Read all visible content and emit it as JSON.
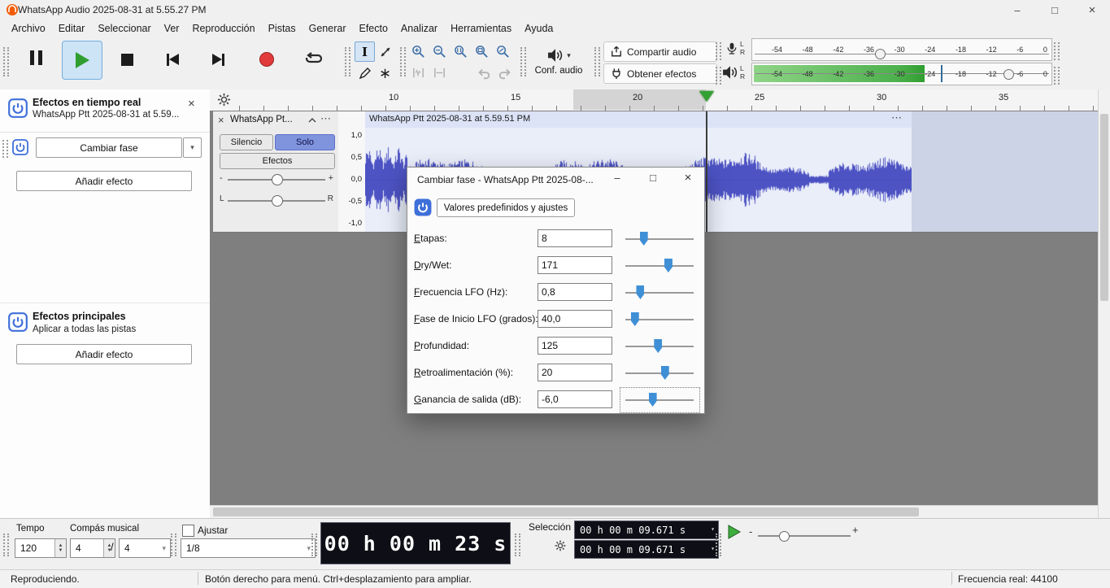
{
  "window": {
    "title": "WhatsApp Audio 2025-08-31 at 5.55.27 PM"
  },
  "menu": {
    "items": [
      "Archivo",
      "Editar",
      "Seleccionar",
      "Ver",
      "Reproducción",
      "Pistas",
      "Generar",
      "Efecto",
      "Analizar",
      "Herramientas",
      "Ayuda"
    ]
  },
  "toolbars": {
    "audio_setup_label": "Conf. audio",
    "share_audio_label": "Compartir audio",
    "get_effects_label": "Obtener efectos",
    "meter_scale": [
      "-54",
      "-48",
      "-42",
      "-36",
      "-30",
      "-24",
      "-18",
      "-12",
      "-6",
      "0"
    ],
    "meter_channel_left": "L",
    "meter_channel_right": "R"
  },
  "timeline": {
    "ticks": [
      "10",
      "15",
      "20",
      "25",
      "30",
      "35"
    ]
  },
  "realtime_panel": {
    "title": "Efectos en tiempo real",
    "subtitle": "WhatsApp Ptt 2025-08-31 at 5.59...",
    "effect_name": "Cambiar fase",
    "add_effect": "Añadir efecto",
    "master_title": "Efectos principales",
    "master_subtitle": "Aplicar a todas las pistas",
    "master_add_effect": "Añadir efecto"
  },
  "track": {
    "name": "WhatsApp Pt...",
    "clip_title": "WhatsApp Ptt 2025-08-31 at 5.59.51 PM",
    "mute_label": "Silencio",
    "solo_label": "Solo",
    "effects_label": "Efectos",
    "gain_minus": "-",
    "gain_plus": "+",
    "pan_left": "L",
    "pan_right": "R",
    "scale": [
      "1,0",
      "0,5",
      "0,0",
      "-0,5",
      "-1,0"
    ]
  },
  "dialog": {
    "title": "Cambiar fase - WhatsApp Ptt 2025-08-...",
    "presets_button": "Valores predefinidos y ajustes",
    "fields": [
      {
        "label": "Etapas:",
        "value": "8",
        "slider": 27
      },
      {
        "label": "Dry/Wet:",
        "value": "171",
        "slider": 63
      },
      {
        "label": "Frecuencia LFO (Hz):",
        "value": "0,8",
        "slider": 22
      },
      {
        "label": "Fase de Inicio LFO (grados):",
        "value": "40,0",
        "slider": 14
      },
      {
        "label": "Profundidad:",
        "value": "125",
        "slider": 48
      },
      {
        "label": "Retroalimentación (%):",
        "value": "20",
        "slider": 58
      },
      {
        "label": "Ganancia de salida (dB):",
        "value": "-6,0",
        "slider": 40
      }
    ]
  },
  "bottom": {
    "tempo_label": "Tempo",
    "tempo_value": "120",
    "time_sig_label": "Compás musical",
    "time_sig_upper": "4",
    "time_sig_divider": "/",
    "time_sig_lower": "4",
    "snap_label": "Ajustar",
    "snap_value": "1/8",
    "time_display": "00 h 00 m 23 s",
    "selection_label": "Selección",
    "selection_start": "00 h 00 m 09.671 s",
    "selection_end": "00 h 00 m 09.671 s",
    "speed_minus": "-",
    "speed_plus": "+"
  },
  "status": {
    "left": "Reproduciendo.",
    "middle": "Botón derecho para menú. Ctrl+desplazamiento para ampliar.",
    "right": "Frecuencia real: 44100"
  },
  "icons": {
    "close": "×",
    "minimize": "–",
    "maximize": "□",
    "chevron_down": "▾",
    "ellipsis": "⋯"
  },
  "colors": {
    "waveform": "#4d53c3",
    "meter_green_light": "#8fd487",
    "meter_green_dark": "#2f9e2f",
    "accent_blue": "#3f8fd6",
    "record_red": "#e23b3b",
    "selection_bg": "#cdd3e6",
    "clip_bg": "#eaeef9"
  }
}
